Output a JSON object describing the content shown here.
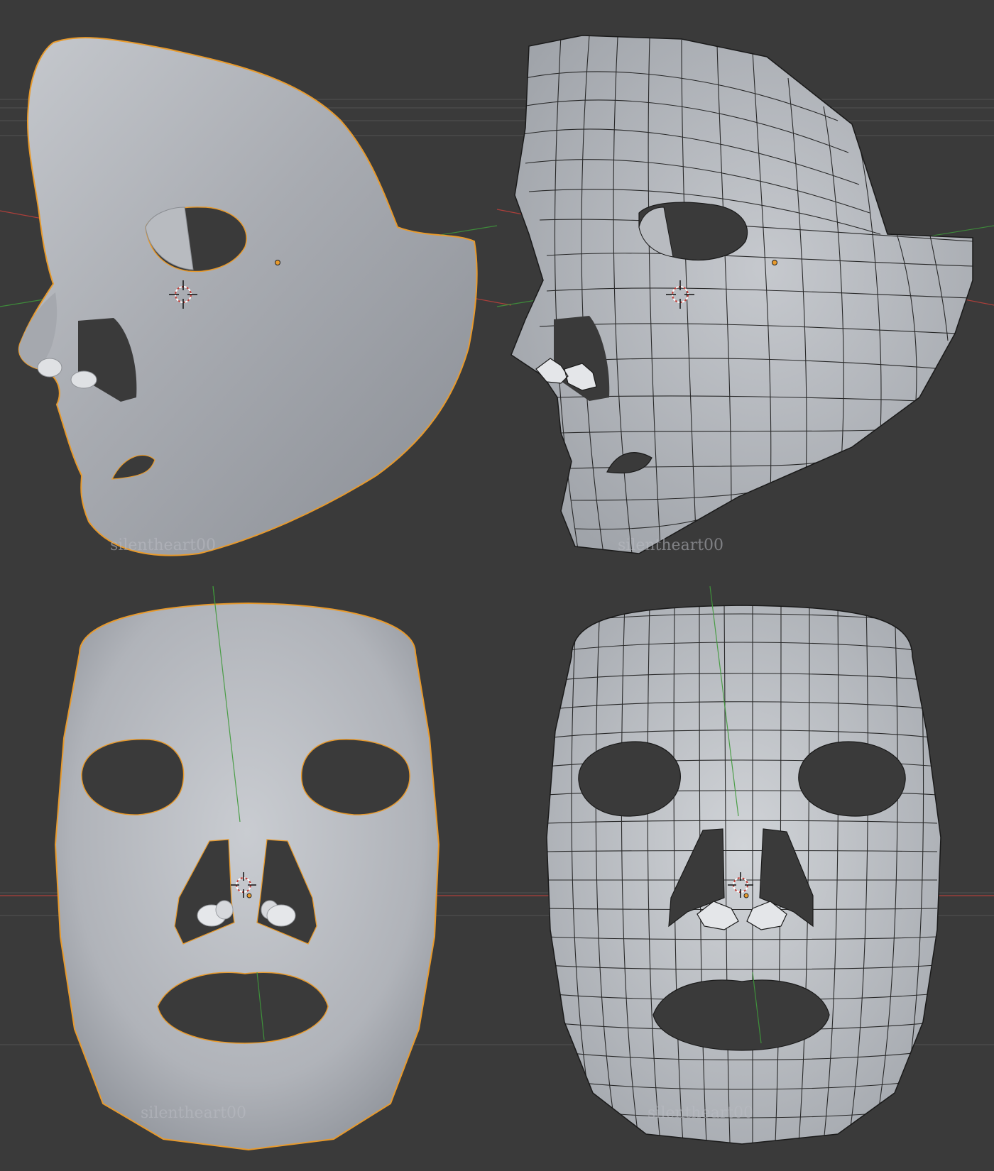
{
  "viewport": {
    "background": "#3a3a3a",
    "grid_line_color": "#4a4a4a",
    "x_axis_color": "#c2403a",
    "y_axis_color": "#3f9a3a",
    "selection_outline_color": "#e89a2c",
    "wire_color": "#1a1a1a",
    "surface_color": "#a9acb2"
  },
  "panels": [
    {
      "id": "side-solid",
      "view": "side",
      "shading": "solid",
      "selected_outline": true,
      "watermark": "silentheart00"
    },
    {
      "id": "side-wire",
      "view": "side",
      "shading": "wireframe",
      "selected_outline": false,
      "watermark": "silentheart00"
    },
    {
      "id": "front-solid",
      "view": "front",
      "shading": "solid",
      "selected_outline": true,
      "watermark": "silentheart00"
    },
    {
      "id": "front-wire",
      "view": "front",
      "shading": "wireframe",
      "selected_outline": false,
      "watermark": "silentheart00"
    }
  ],
  "icons": {
    "cursor": "3d-cursor-icon",
    "origin": "object-origin-icon"
  }
}
